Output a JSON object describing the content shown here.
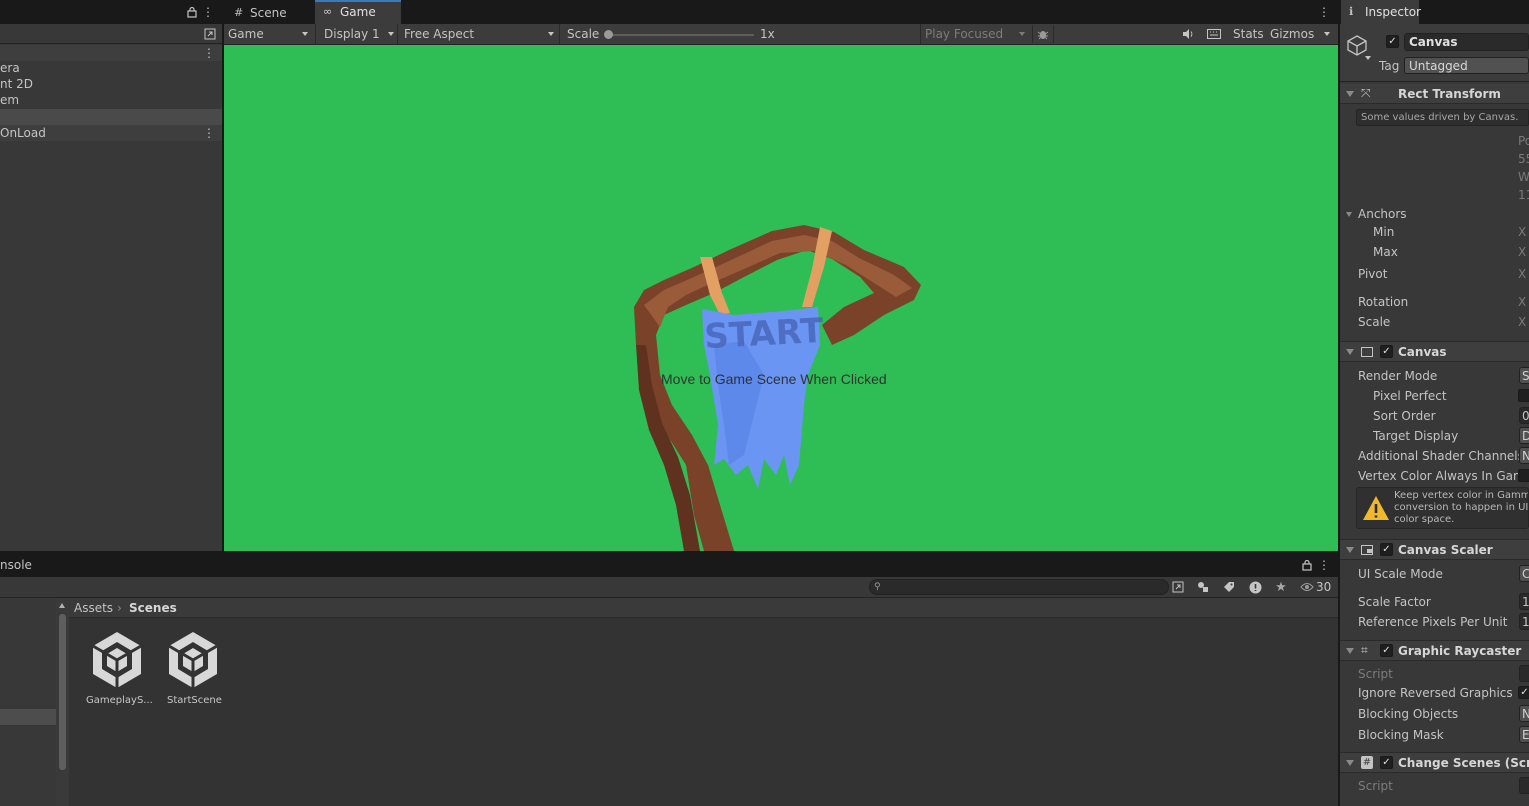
{
  "hierarchy": {
    "items": [
      "era",
      "nt 2D",
      "em"
    ],
    "dontdestroy": "OnLoad"
  },
  "tabs": {
    "scene": "Scene",
    "game": "Game"
  },
  "game_toolbar": {
    "view_mode": "Game",
    "display": "Display 1",
    "aspect": "Free Aspect",
    "scale_label": "Scale",
    "scale_value": "1x",
    "play_mode": "Play Focused",
    "stats": "Stats",
    "gizmos": "Gizmos"
  },
  "game_view": {
    "background_color": "#2fbd56",
    "sign_text": "START",
    "button_label": "Move to Game Scene When Clicked"
  },
  "bottom": {
    "tab": "nsole",
    "breadcrumb_root": "Assets",
    "breadcrumb_current": "Scenes",
    "hidden_count": "30",
    "assets": [
      "GameplayS...",
      "StartScene"
    ]
  },
  "inspector": {
    "tab": "Inspector",
    "object_name": "Canvas",
    "tag_label": "Tag",
    "tag_value": "Untagged",
    "rect_transform": {
      "title": "Rect Transform",
      "note": "Some values driven by Canvas.",
      "right_bits": [
        "Po",
        "55",
        "W",
        "11"
      ],
      "anchors": "Anchors",
      "min": "Min",
      "max": "Max",
      "pivot": "Pivot",
      "rotation": "Rotation",
      "scale": "Scale",
      "axis": "X"
    },
    "canvas": {
      "title": "Canvas",
      "render_mode": "Render Mode",
      "pixel_perfect": "Pixel Perfect",
      "sort_order": "Sort Order",
      "target_display": "Target Display",
      "additional_shader": "Additional Shader Channels",
      "vertex_color": "Vertex Color Always In Gamm",
      "warning": [
        "Keep vertex color in Gamma",
        "conversion to happen in UI s",
        "color space."
      ],
      "render_mode_val": "S",
      "sort_order_val": "0",
      "target_display_val": "D",
      "additional_val": "N"
    },
    "canvas_scaler": {
      "title": "Canvas Scaler",
      "ui_scale_mode": "UI Scale Mode",
      "scale_factor": "Scale Factor",
      "ref_pixels": "Reference Pixels Per Unit",
      "ui_scale_val": "C",
      "scale_factor_val": "1",
      "ref_pixels_val": "1("
    },
    "graphic_raycaster": {
      "title": "Graphic Raycaster",
      "script": "Script",
      "ignore_reversed": "Ignore Reversed Graphics",
      "blocking_objects": "Blocking Objects",
      "blocking_mask": "Blocking Mask",
      "blocking_objects_val": "N",
      "blocking_mask_val": "E"
    },
    "change_scenes": {
      "title": "Change Scenes (Scr",
      "script": "Script"
    }
  }
}
